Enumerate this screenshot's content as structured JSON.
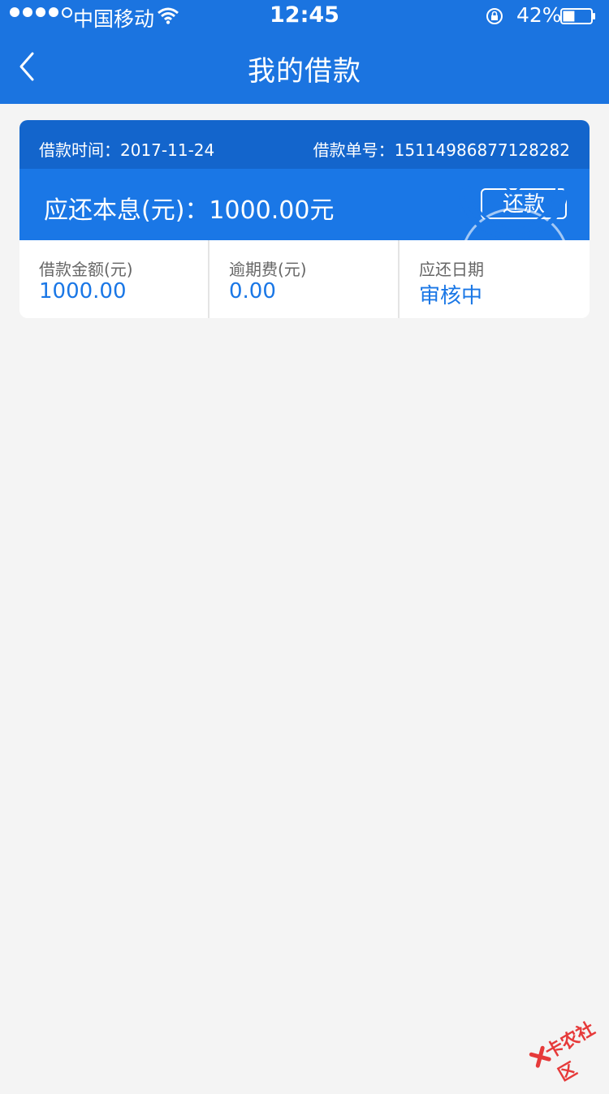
{
  "status_bar": {
    "carrier": "中国移动",
    "time": "12:45",
    "battery_percent": "42%",
    "battery_level": 0.42
  },
  "nav": {
    "back_icon": "chevron-left-icon",
    "title": "我的借款"
  },
  "loan": {
    "date_label": "借款时间：2017-11-24",
    "order_label": "借款单号：15114986877128282",
    "due_label": "应还本息(元)：1000.00元",
    "repay_button": "还款",
    "stats": [
      {
        "label": "借款金额(元)",
        "value": "1000.00"
      },
      {
        "label": "逾期费(元)",
        "value": "0.00"
      },
      {
        "label": "应还日期",
        "value": "审核中"
      }
    ]
  },
  "watermark": {
    "text": "卡农社区"
  },
  "colors": {
    "primary": "#1b74e0",
    "header_dark": "#1365cc",
    "value_blue": "#1a77e6",
    "background": "#f4f4f4"
  }
}
